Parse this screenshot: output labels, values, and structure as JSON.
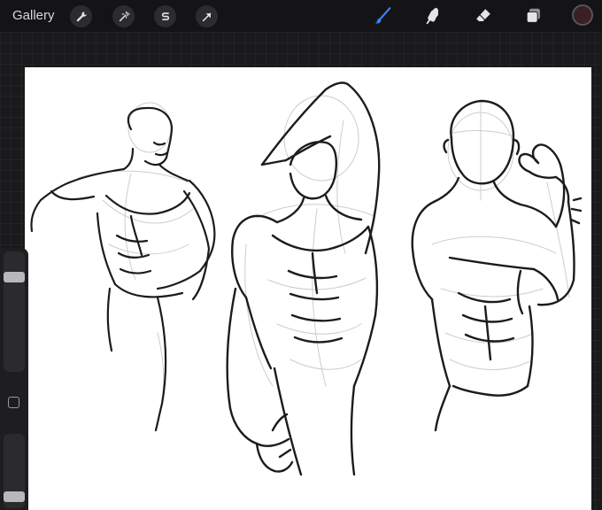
{
  "toolbar": {
    "gallery_label": "Gallery",
    "left_tools": [
      {
        "icon": "wrench-icon"
      },
      {
        "icon": "magic-wand-icon"
      },
      {
        "icon": "adjustments-s-icon"
      },
      {
        "icon": "selection-arrow-icon"
      }
    ],
    "right_tools": [
      {
        "icon": "brush-icon",
        "active": true
      },
      {
        "icon": "smudge-icon"
      },
      {
        "icon": "eraser-icon"
      },
      {
        "icon": "layers-icon"
      }
    ],
    "current_color": "#3a1f24",
    "active_color": "#3b82f6"
  },
  "sidebar": {
    "brush_size_level": 0.84,
    "brush_opacity_level": 0.05
  }
}
